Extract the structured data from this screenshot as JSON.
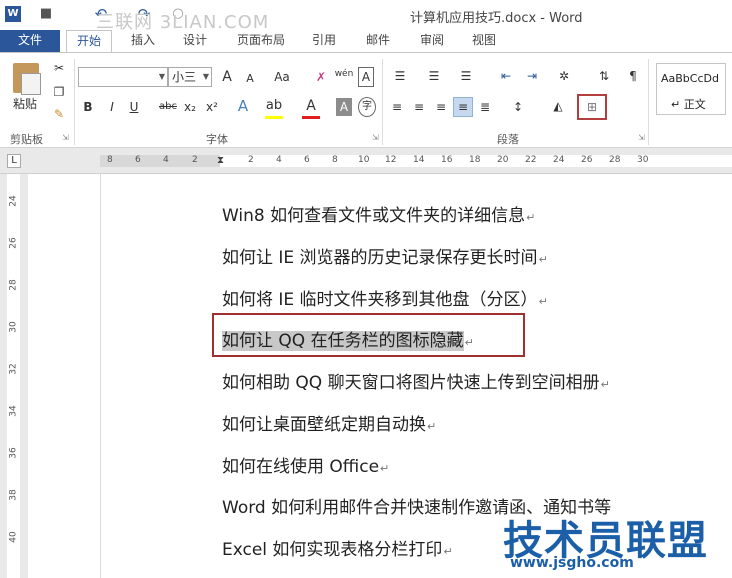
{
  "titlebar": {
    "watermark": "三联网 3LIAN.COM",
    "doc_title": "计算机应用技巧.docx - Word"
  },
  "tabs": [
    "文件",
    "开始",
    "插入",
    "设计",
    "页面布局",
    "引用",
    "邮件",
    "审阅",
    "视图"
  ],
  "ribbon": {
    "paste_label": "粘贴",
    "clipboard_label": "剪贴板",
    "font_label": "字体",
    "paragraph_label": "段落",
    "font_name": "",
    "font_size": "小三",
    "grow_font": "A",
    "shrink_font": "A",
    "change_case": "Aa",
    "phonetic": "wén",
    "char_border": "A",
    "bold": "B",
    "italic": "I",
    "underline": "U",
    "strike": "abc",
    "subscript": "x₂",
    "superscript": "x²",
    "text_effect": "A",
    "font_color": "A",
    "char_shading": "A",
    "enclose": "字",
    "style_sample": "AaBbCcDd",
    "style_name": "↵ 正文",
    "highlight_color": "#ffff00",
    "font_color_value": "#e02020",
    "accent": "#2b579a"
  },
  "ruler": {
    "h_numbers": [
      "8",
      "6",
      "4",
      "2",
      "2",
      "4",
      "6",
      "8",
      "10",
      "12",
      "14",
      "16",
      "18",
      "20",
      "22",
      "24",
      "26",
      "28",
      "30"
    ],
    "v_numbers": [
      "24",
      "26",
      "28",
      "30",
      "32",
      "34",
      "36",
      "38",
      "40"
    ]
  },
  "document": {
    "paragraphs": [
      "Win8 如何查看文件或文件夹的详细信息",
      "如何让 IE 浏览器的历史记录保存更长时间",
      "如何将 IE 临时文件夹移到其他盘（分区）",
      "如何让 QQ 在任务栏的图标隐藏",
      "如何相助 QQ 聊天窗口将图片快速上传到空间相册",
      "如何让桌面壁纸定期自动换",
      "如何在线使用 Office",
      "Word 如何利用邮件合并快速制作邀请函、通知书等",
      "Excel 如何实现表格分栏打印"
    ],
    "para_mark": "↵"
  },
  "brand": {
    "name": "技术员联盟",
    "url": "www.jsgho.com"
  }
}
